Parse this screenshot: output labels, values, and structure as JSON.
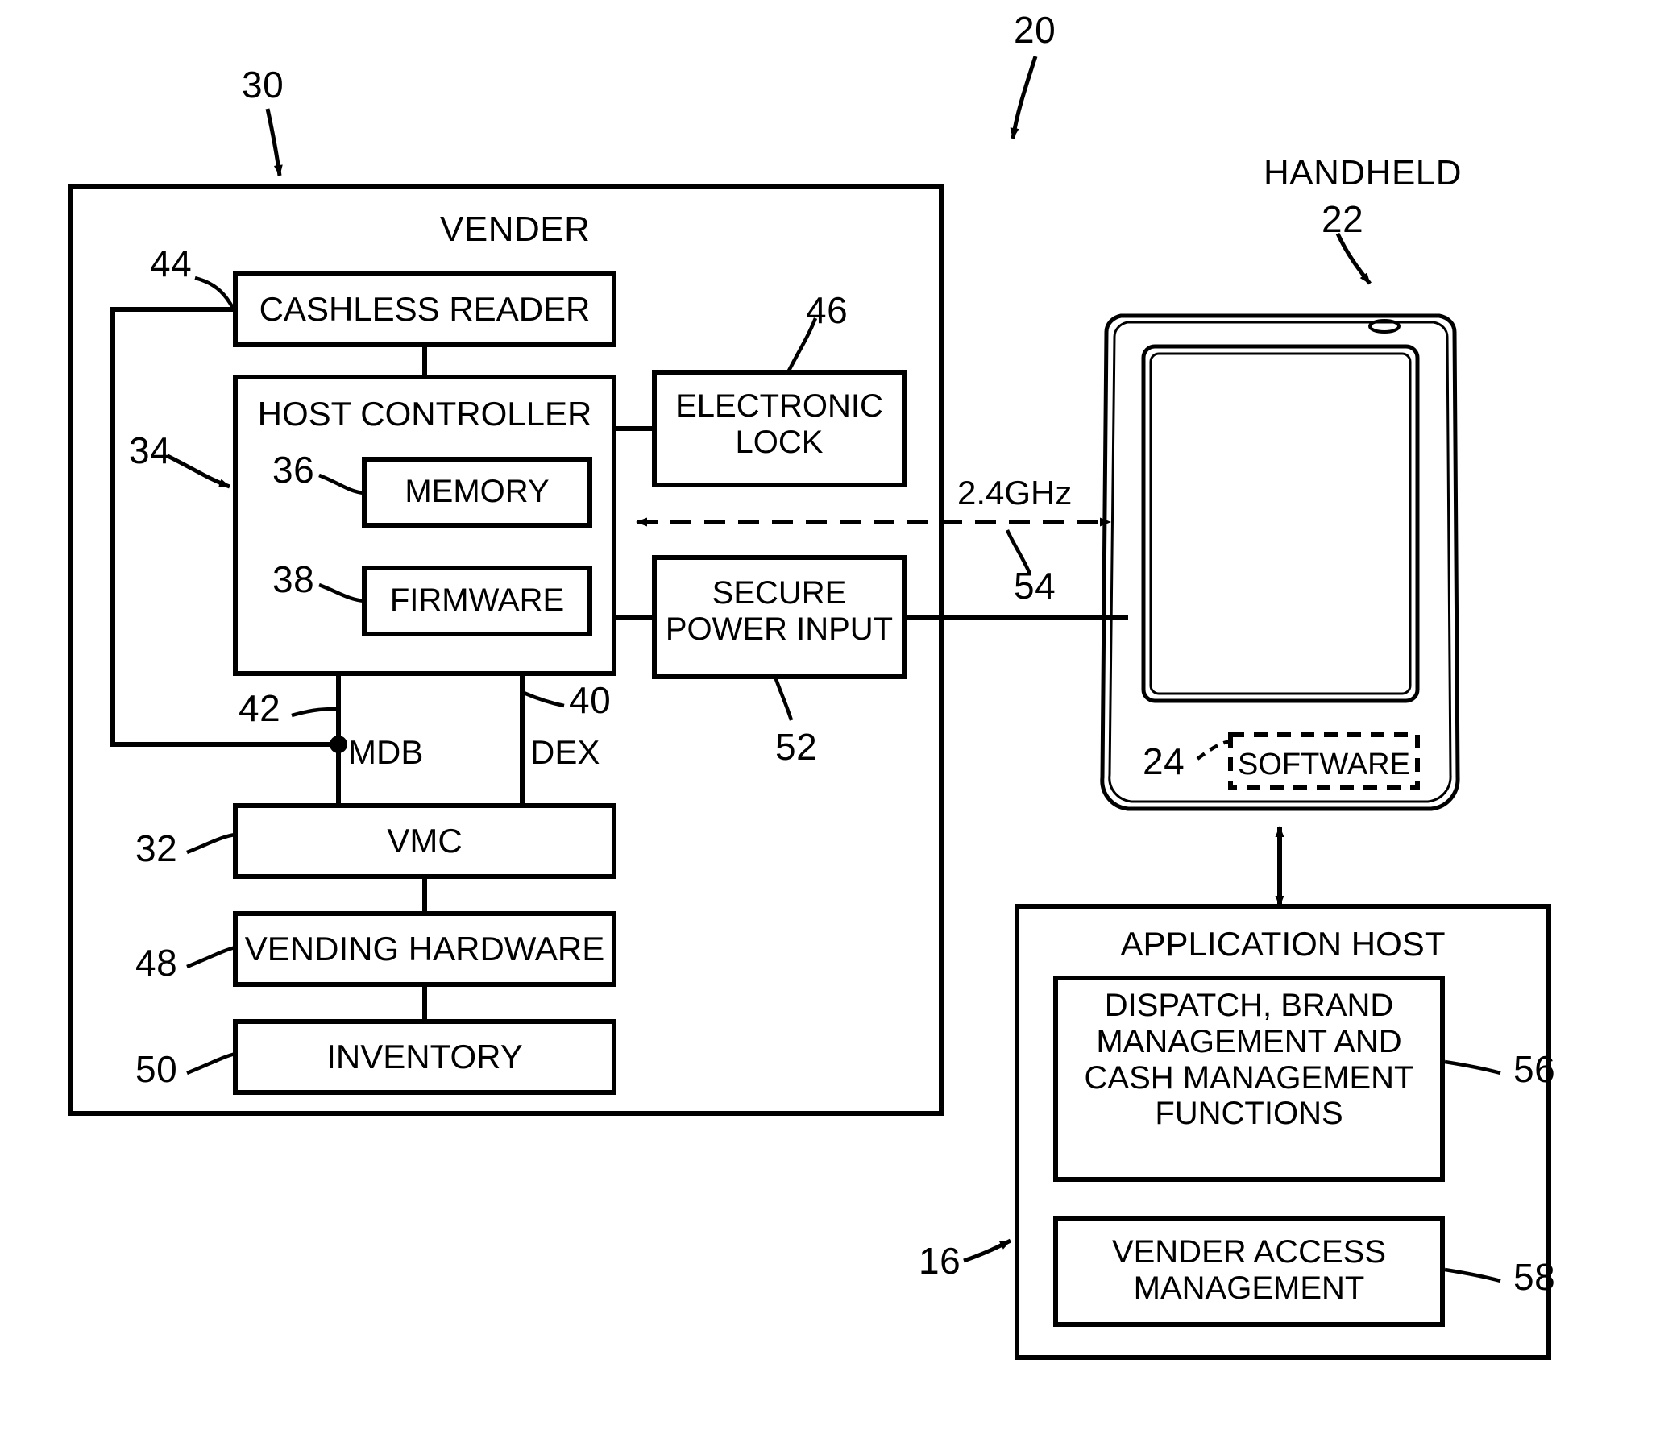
{
  "figure": {
    "type": "patent-block-diagram",
    "ref_20": "20",
    "ref_30": "30",
    "ref_22": "22",
    "ref_16": "16",
    "ref_24": "24",
    "ref_32": "32",
    "ref_34": "34",
    "ref_36": "36",
    "ref_38": "38",
    "ref_40": "40",
    "ref_42": "42",
    "ref_44": "44",
    "ref_46": "46",
    "ref_48": "48",
    "ref_50": "50",
    "ref_52": "52",
    "ref_54": "54",
    "ref_56": "56",
    "ref_58": "58"
  },
  "vender": {
    "title": "VENDER",
    "cashless_reader": "CASHLESS READER",
    "host_controller": "HOST CONTROLLER",
    "memory": "MEMORY",
    "firmware": "FIRMWARE",
    "electronic_lock": "ELECTRONIC\nLOCK",
    "secure_power_input": "SECURE\nPOWER INPUT",
    "mdb_label": "MDB",
    "dex_label": "DEX",
    "vmc": "VMC",
    "vending_hardware": "VENDING HARDWARE",
    "inventory": "INVENTORY"
  },
  "handheld": {
    "title": "HANDHELD",
    "software": "SOFTWARE"
  },
  "link": {
    "wireless_label": "2.4GHz"
  },
  "application_host": {
    "title": "APPLICATION HOST",
    "functions_block": "DISPATCH, BRAND\nMANAGEMENT AND\nCASH MANAGEMENT\nFUNCTIONS",
    "access_block": "VENDER ACCESS\nMANAGEMENT"
  }
}
